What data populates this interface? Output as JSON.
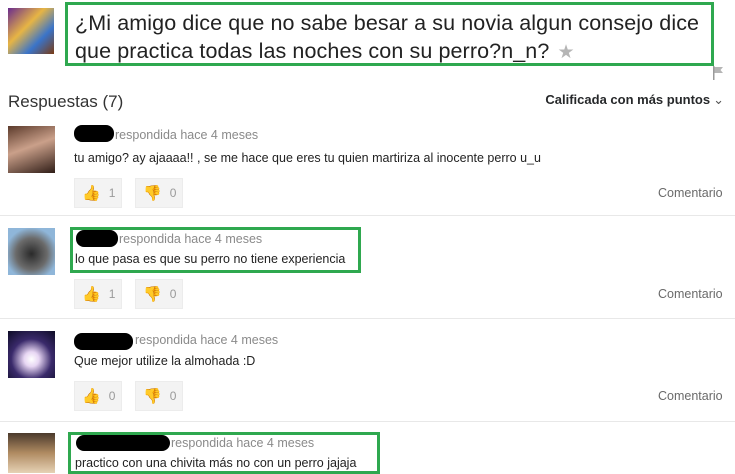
{
  "question": {
    "text": "¿Mi amigo dice que no sabe besar a su novia algun consejo dice que practica todas las noches con su perro?n_n?"
  },
  "answers_header": {
    "title": "Respuestas (7)",
    "sort_label": "Calificada con más puntos"
  },
  "answers": [
    {
      "meta": "respondida hace 4 meses",
      "text": "tu amigo? ay ajaaaa!! , se me hace que eres tu quien martiriza al inocente perro u_u",
      "up": "1",
      "down": "0",
      "comment": "Comentario"
    },
    {
      "meta": "respondida hace 4 meses",
      "text": "lo que pasa es que su perro no tiene experiencia",
      "up": "1",
      "down": "0",
      "comment": "Comentario"
    },
    {
      "meta": "respondida hace 4 meses",
      "text": "Que mejor utilize la almohada :D",
      "up": "0",
      "down": "0",
      "comment": "Comentario"
    },
    {
      "meta": "respondida hace 4 meses",
      "text": "practico con una chivita más no con un perro jajaja"
    }
  ],
  "colors": {
    "highlight": "#2fa84f",
    "background": "#ffffff"
  }
}
